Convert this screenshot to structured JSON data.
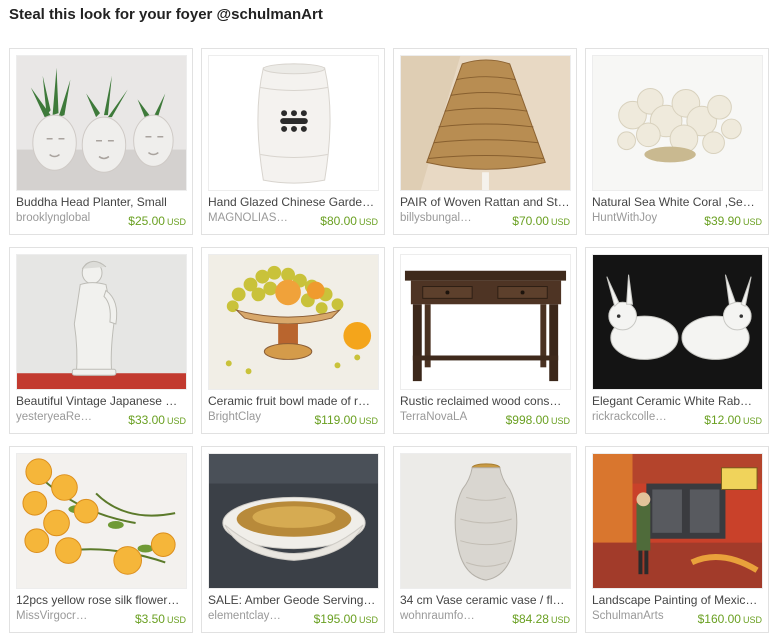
{
  "page": {
    "title": "Steal this look for your foyer @schulmanArt"
  },
  "items": [
    {
      "name": "Buddha Head Planter, Small",
      "shop": "brooklynglobal",
      "price": "$25.00",
      "currency": "USD",
      "image": "buddha-planters"
    },
    {
      "name": "Hand Glazed Chinese Garde…",
      "shop": "MAGNOLIAS…",
      "price": "$80.00",
      "currency": "USD",
      "image": "garden-stool"
    },
    {
      "name": "PAIR of Woven Rattan and St…",
      "shop": "billysbungal…",
      "price": "$70.00",
      "currency": "USD",
      "image": "rattan-shade"
    },
    {
      "name": "Natural Sea White Coral ,Se…",
      "shop": "HuntWithJoy",
      "price": "$39.90",
      "currency": "USD",
      "image": "white-coral"
    },
    {
      "name": "Beautiful Vintage Japanese …",
      "shop": "yesteryeaRe…",
      "price": "$33.00",
      "currency": "USD",
      "image": "japanese-figurine"
    },
    {
      "name": "Ceramic fruit bowl made of r…",
      "shop": "BrightClay",
      "price": "$119.00",
      "currency": "USD",
      "image": "fruit-bowl"
    },
    {
      "name": "Rustic reclaimed wood cons…",
      "shop": "TerraNovaLA",
      "price": "$998.00",
      "currency": "USD",
      "image": "console-table"
    },
    {
      "name": "Elegant Ceramic White Rab…",
      "shop": "rickrackcolle…",
      "price": "$12.00",
      "currency": "USD",
      "image": "ceramic-rabbits"
    },
    {
      "name": "12pcs yellow rose silk flower…",
      "shop": "MissVirgocr…",
      "price": "$3.50",
      "currency": "USD",
      "image": "yellow-roses"
    },
    {
      "name": "SALE: Amber Geode Serving…",
      "shop": "elementclay…",
      "price": "$195.00",
      "currency": "USD",
      "image": "geode-bowl"
    },
    {
      "name": "34 cm Vase ceramic vase / fl…",
      "shop": "wohnraumfo…",
      "price": "$84.28",
      "currency": "USD",
      "image": "ceramic-vase"
    },
    {
      "name": "Landscape Painting of Mexic…",
      "shop": "SchulmanArts",
      "price": "$160.00",
      "currency": "USD",
      "image": "mexico-painting"
    }
  ]
}
